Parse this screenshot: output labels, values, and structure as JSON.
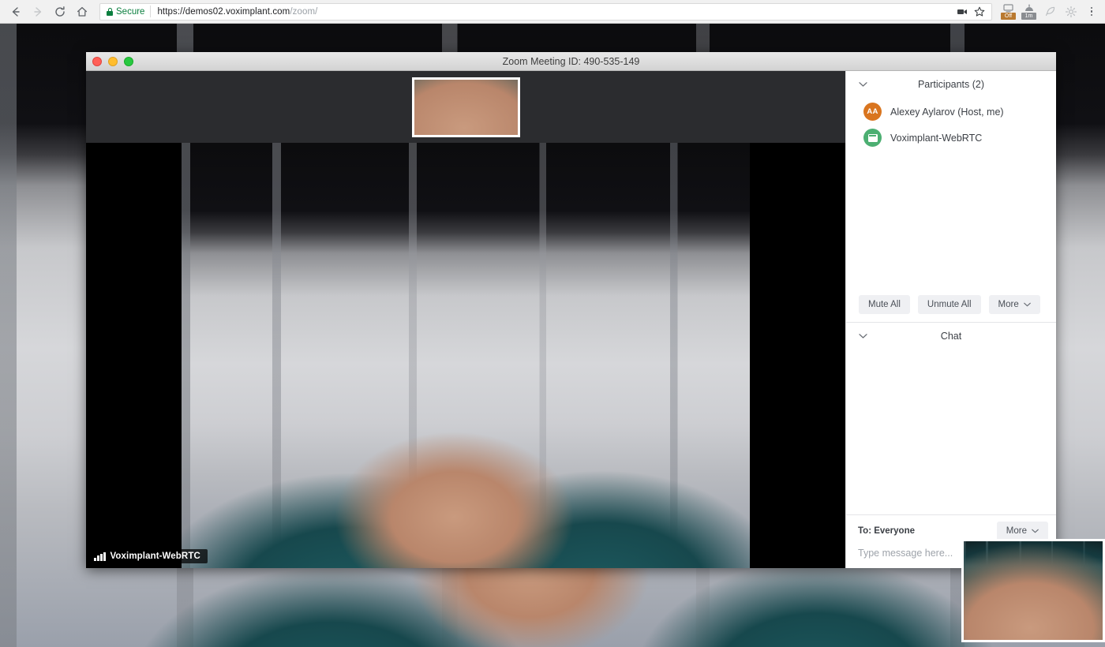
{
  "browser": {
    "nav": {
      "back_icon": "arrow-left-icon",
      "forward_icon": "arrow-right-icon",
      "reload_icon": "reload-icon",
      "home_icon": "home-icon"
    },
    "omnibox": {
      "security_label": "Secure",
      "lock_icon": "lock-icon",
      "url_scheme": "https://",
      "url_host": "demos02.voximplant.com",
      "url_path": "/zoom/",
      "full_url": "https://demos02.voximplant.com/zoom/",
      "cast_icon": "video-cast-icon",
      "bookmark_icon": "star-icon"
    },
    "extensions": [
      {
        "name": "adblock-extension-icon",
        "badge": "Off",
        "badge_color": "#b9792f"
      },
      {
        "name": "timer-extension-icon",
        "badge": "1m",
        "badge_color": "#8a8d91"
      },
      {
        "name": "feather-extension-icon",
        "badge": ""
      },
      {
        "name": "settings-extension-icon",
        "badge": ""
      }
    ],
    "menu_icon": "three-dots-menu-icon"
  },
  "zoom_window": {
    "title": "Zoom Meeting ID: 490-535-149",
    "traffic_lights": {
      "close": "close-window-button",
      "minimize": "minimize-window-button",
      "maximize": "maximize-window-button"
    },
    "video": {
      "self_thumbnail_name": "self-view-thumbnail",
      "active_speaker_label": "Voximplant-WebRTC",
      "signal_icon": "signal-bars-icon"
    },
    "participants_panel": {
      "collapse_icon": "chevron-down-icon",
      "title": "Participants (2)",
      "count": 2,
      "people": [
        {
          "name": "Alexey Aylarov (Host, me)",
          "avatar_type": "initials",
          "initials": "AA",
          "avatar_color": "#d9751f"
        },
        {
          "name": "Voximplant-WebRTC",
          "avatar_type": "device",
          "initials": "",
          "avatar_color": "#4caf72"
        }
      ],
      "actions": [
        {
          "label": "Mute All",
          "name": "mute-all-button",
          "has_chevron": false
        },
        {
          "label": "Unmute All",
          "name": "unmute-all-button",
          "has_chevron": false
        },
        {
          "label": "More",
          "name": "participants-more-button",
          "has_chevron": true
        }
      ],
      "chevron_glyph": "⌄"
    },
    "chat_panel": {
      "collapse_icon": "chevron-down-icon",
      "title": "Chat",
      "to_label": "To: Everyone",
      "more_label": "More",
      "more_chevron": "⌄",
      "input_placeholder": "Type message here...",
      "input_value": ""
    }
  },
  "page": {
    "pip_self_view_name": "page-self-view-pip"
  },
  "colors": {
    "secure_green": "#0b7f3f",
    "avatar_orange": "#d9751f",
    "avatar_green": "#4caf72",
    "panel_bg": "#ffffff",
    "window_chrome": "#d3d3d3",
    "video_bg": "#000000"
  }
}
